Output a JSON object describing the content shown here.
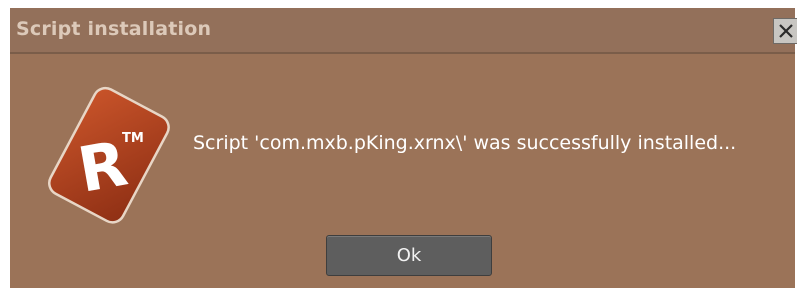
{
  "dialog": {
    "title": "Script installation",
    "close_icon": "close-icon",
    "logo_icon": "renoise-logo-icon",
    "logo_mark": "R™",
    "message": "Script 'com.mxb.pKing.xrnx\\' was successfully installed...",
    "ok_label": "Ok"
  },
  "colors": {
    "dialog_bg": "#9b7358",
    "titlebar_bg": "#93705a",
    "title_text": "#dcc9b9",
    "logo_red": "#b5401f",
    "button_bg": "#5e5e5e"
  }
}
